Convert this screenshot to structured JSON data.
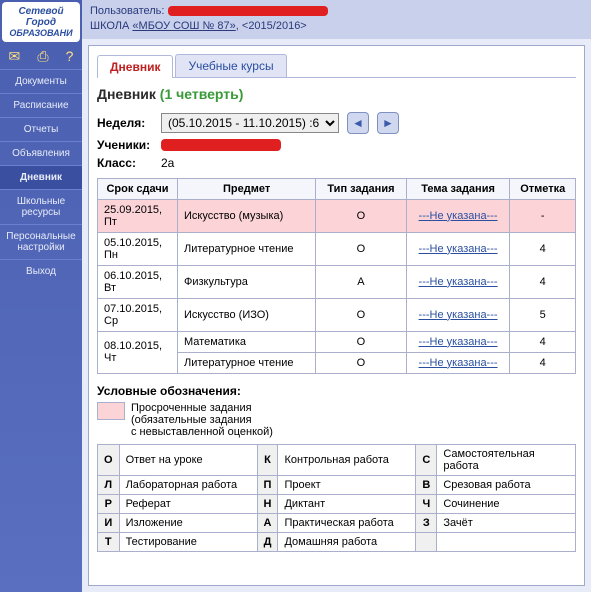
{
  "logo": {
    "line1": "Сетевой",
    "line2": "Город",
    "line3": "ОБРАЗОВАНИ"
  },
  "header": {
    "user_label": "Пользователь:",
    "school_label": "ШКОЛА",
    "school_link": "«МБОУ СОШ № 87»",
    "year": "<2015/2016>"
  },
  "nav": [
    "Документы",
    "Расписание",
    "Отчеты",
    "Объявления",
    "Дневник",
    "Школьные ресурсы",
    "Персональные настройки",
    "Выход"
  ],
  "nav_active_index": 4,
  "tabs": [
    "Дневник",
    "Учебные курсы"
  ],
  "tab_active_index": 0,
  "title_main": "Дневник",
  "title_term": "(1 четверть)",
  "filters": {
    "week_label": "Неделя:",
    "week_value": "(05.10.2015 - 11.10.2015) :6",
    "students_label": "Ученики:",
    "class_label": "Класс:",
    "class_value": "2а"
  },
  "grade_headers": [
    "Срок сдачи",
    "Предмет",
    "Тип задания",
    "Тема задания",
    "Отметка"
  ],
  "grade_rows": [
    {
      "date": "25.09.2015, Пт",
      "subject": "Искусство (музыка)",
      "type": "О",
      "topic": "---Не указана---",
      "mark": "-",
      "overdue": true
    },
    {
      "date": "05.10.2015, Пн",
      "subject": "Литературное чтение",
      "type": "О",
      "topic": "---Не указана---",
      "mark": "4",
      "overdue": false
    },
    {
      "date": "06.10.2015, Вт",
      "subject": "Физкультура",
      "type": "А",
      "topic": "---Не указана---",
      "mark": "4",
      "overdue": false
    },
    {
      "date": "07.10.2015, Ср",
      "subject": "Искусство (ИЗО)",
      "type": "О",
      "topic": "---Не указана---",
      "mark": "5",
      "overdue": false
    },
    {
      "date": "08.10.2015, Чт",
      "subject": "Математика",
      "type": "О",
      "topic": "---Не указана---",
      "mark": "4",
      "overdue": false,
      "rowspan_date": 2
    },
    {
      "date": "",
      "subject": "Литературное чтение",
      "type": "О",
      "topic": "---Не указана---",
      "mark": "4",
      "overdue": false,
      "skip_date": true
    }
  ],
  "legend_title": "Условные обозначения:",
  "legend_overdue": "Просроченные задания\n(обязательные задания\nс невыставленной оценкой)",
  "legend_codes": [
    [
      {
        "c": "О",
        "d": "Ответ на уроке"
      },
      {
        "c": "К",
        "d": "Контрольная работа"
      },
      {
        "c": "С",
        "d": "Самостоятельная работа"
      }
    ],
    [
      {
        "c": "Л",
        "d": "Лабораторная работа"
      },
      {
        "c": "П",
        "d": "Проект"
      },
      {
        "c": "В",
        "d": "Срезовая работа"
      }
    ],
    [
      {
        "c": "Р",
        "d": "Реферат"
      },
      {
        "c": "Н",
        "d": "Диктант"
      },
      {
        "c": "Ч",
        "d": "Сочинение"
      }
    ],
    [
      {
        "c": "И",
        "d": "Изложение"
      },
      {
        "c": "А",
        "d": "Практическая работа"
      },
      {
        "c": "З",
        "d": "Зачёт"
      }
    ],
    [
      {
        "c": "Т",
        "d": "Тестирование"
      },
      {
        "c": "Д",
        "d": "Домашняя работа"
      },
      null
    ]
  ]
}
